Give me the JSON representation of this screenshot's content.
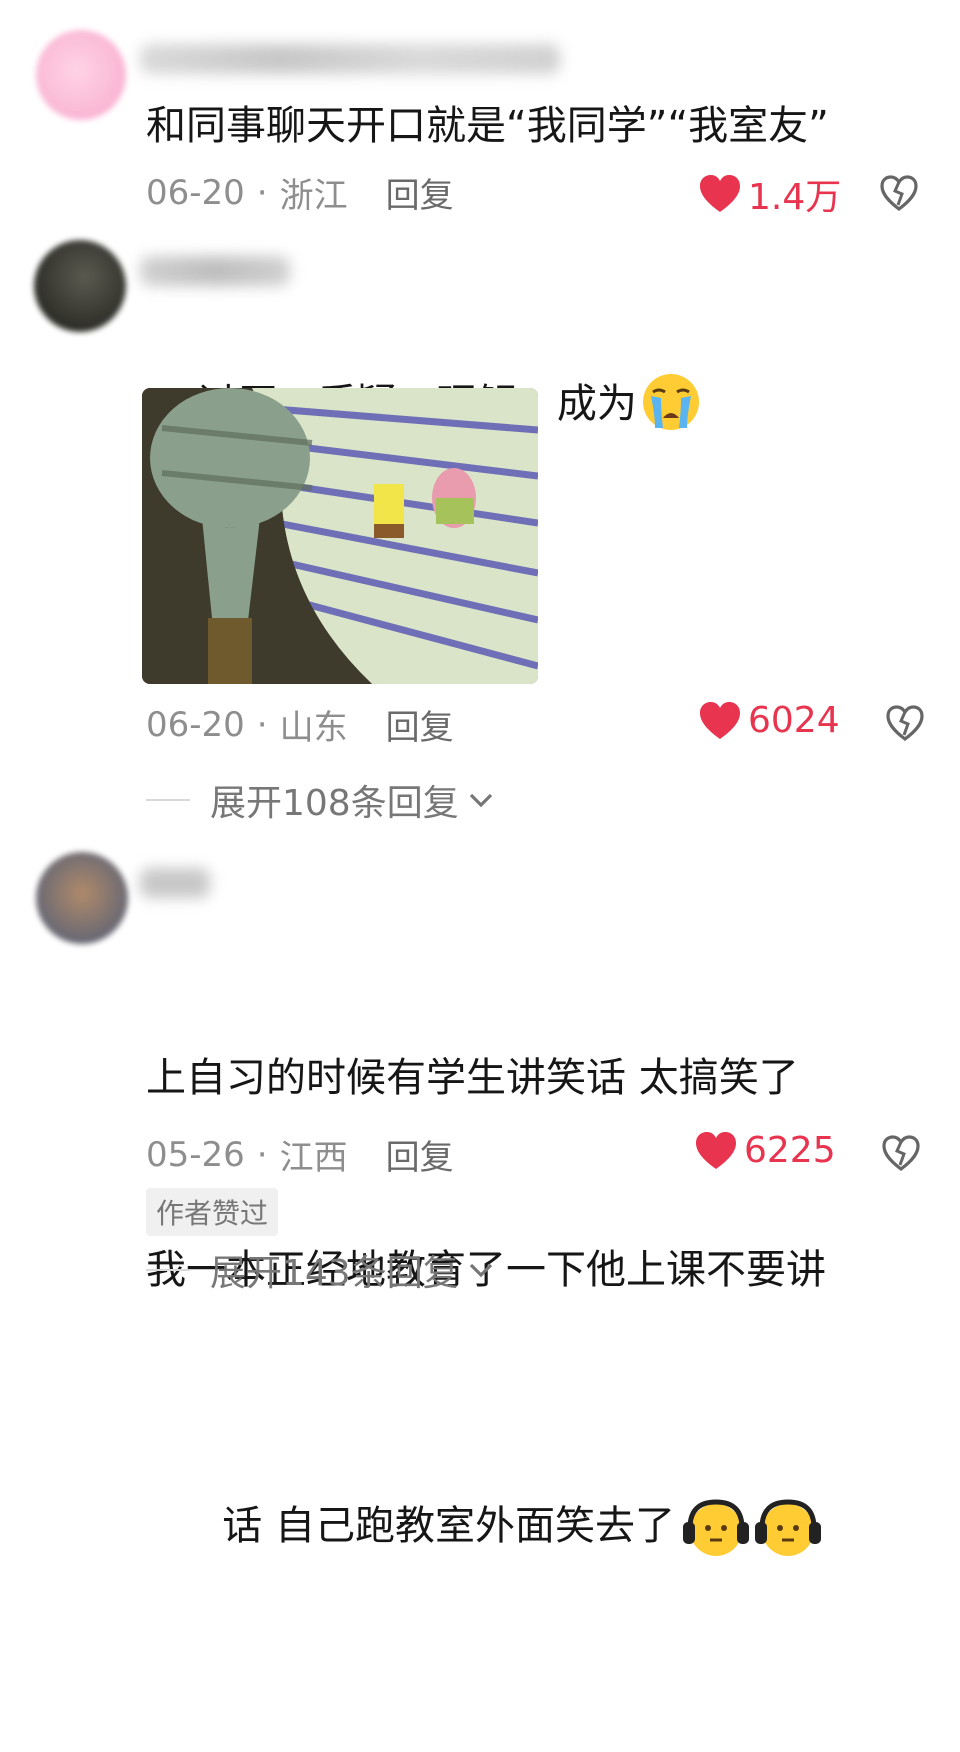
{
  "comments": [
    {
      "text": "和同事聊天开口就是“我同学”“我室友”",
      "date": "06-20",
      "location": "浙江",
      "reply_label": "回复",
      "likes": "1.4万"
    },
    {
      "text": "讨厌，质疑，理解，成为",
      "date": "06-20",
      "location": "山东",
      "reply_label": "回复",
      "likes": "6024",
      "expand_label": "展开108条回复"
    },
    {
      "text_line1": "上自习的时候有学生讲笑话 太搞笑了",
      "text_line2": "我一本正经地教育了一下他上课不要讲",
      "text_line3": "话 自己跑教室外面笑去了",
      "date": "05-26",
      "location": "江西",
      "reply_label": "回复",
      "likes": "6225",
      "badge": "作者赞过",
      "expand_label": "展开143条回复"
    }
  ],
  "separator": "·",
  "colors": {
    "like": "#e8344f",
    "meta": "#8e8e8e",
    "text": "#161616"
  },
  "icons": [
    "heart-icon",
    "broken-heart-icon",
    "chevron-down-icon",
    "crying-face-emoji",
    "headphones-face-emoji"
  ]
}
